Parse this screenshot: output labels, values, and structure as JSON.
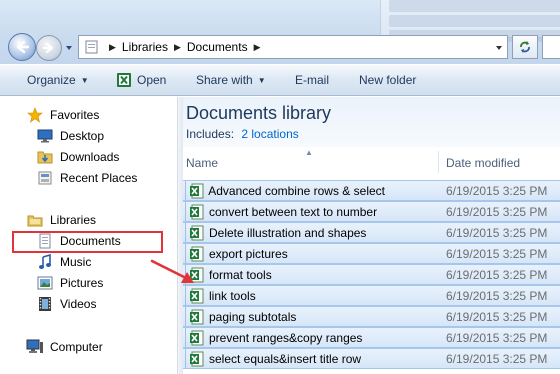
{
  "address_bar": {
    "breadcrumbs": [
      "Libraries",
      "Documents"
    ]
  },
  "toolbar": {
    "organize_label": "Organize",
    "open_label": "Open",
    "share_with_label": "Share with",
    "email_label": "E-mail",
    "new_folder_label": "New folder"
  },
  "nav": {
    "favorites_label": "Favorites",
    "favorites": [
      "Desktop",
      "Downloads",
      "Recent Places"
    ],
    "libraries_label": "Libraries",
    "libraries": [
      "Documents",
      "Music",
      "Pictures",
      "Videos"
    ],
    "computer_label": "Computer",
    "selected_item": "Documents"
  },
  "library": {
    "title": "Documents library",
    "includes_label": "Includes:",
    "includes_link": "2 locations"
  },
  "columns": {
    "name": "Name",
    "date_modified": "Date modified"
  },
  "files": [
    {
      "name": "Advanced combine rows & select",
      "date": "6/19/2015 3:25 PM"
    },
    {
      "name": "convert between text to number",
      "date": "6/19/2015 3:25 PM"
    },
    {
      "name": "Delete illustration and shapes",
      "date": "6/19/2015 3:25 PM"
    },
    {
      "name": "export pictures",
      "date": "6/19/2015 3:25 PM"
    },
    {
      "name": "format tools",
      "date": "6/19/2015 3:25 PM"
    },
    {
      "name": "link tools",
      "date": "6/19/2015 3:25 PM"
    },
    {
      "name": "paging subtotals",
      "date": "6/19/2015 3:25 PM"
    },
    {
      "name": "prevent ranges&copy ranges",
      "date": "6/19/2015 3:25 PM"
    },
    {
      "name": "select equals&insert title row",
      "date": "6/19/2015 3:25 PM"
    }
  ],
  "colors": {
    "highlight": "#e0333a",
    "link": "#0066cc",
    "title": "#1e395b",
    "selection": "#d6e6f8"
  },
  "icons": {
    "file": "excel-file-icon",
    "favorites": "star-icon",
    "desktop": "desktop-icon",
    "downloads": "downloads-folder-icon",
    "recent": "recent-places-icon",
    "libraries": "libraries-icon",
    "documents": "document-icon",
    "music": "music-note-icon",
    "pictures": "pictures-icon",
    "videos": "film-icon",
    "computer": "computer-icon"
  }
}
